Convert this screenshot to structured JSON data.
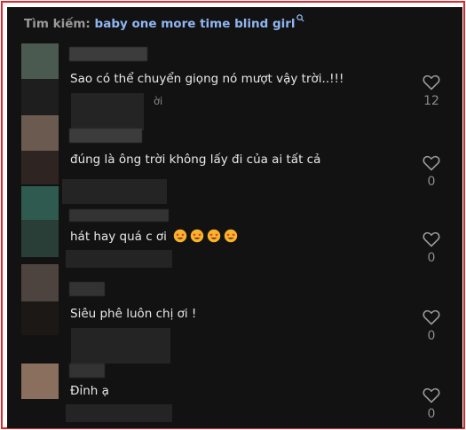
{
  "search": {
    "label": "Tìm kiếm:",
    "query": "baby one more time blind girl"
  },
  "comments": [
    {
      "text": "Sao có thể chuyển giọng nó mượt vậy trời..!!!",
      "meta_suffix": "ời",
      "likes": "12"
    },
    {
      "text": "đúng là ông trời không lấy đi của ai tất cả",
      "likes": "0"
    },
    {
      "text": "hát hay quá c ơi",
      "emoji_count": 4,
      "likes": "0"
    },
    {
      "text": "Siêu phê luôn chị ơi !",
      "likes": "0"
    },
    {
      "text": "Đỉnh ạ",
      "likes": "0"
    }
  ],
  "colors": {
    "frame_border": "#e0262a",
    "panel_bg": "#121212",
    "query_text": "#8fb6f2"
  },
  "icons": {
    "search": "search-icon",
    "like": "heart-outline-icon",
    "emoji": "star-struck-emoji-icon"
  }
}
